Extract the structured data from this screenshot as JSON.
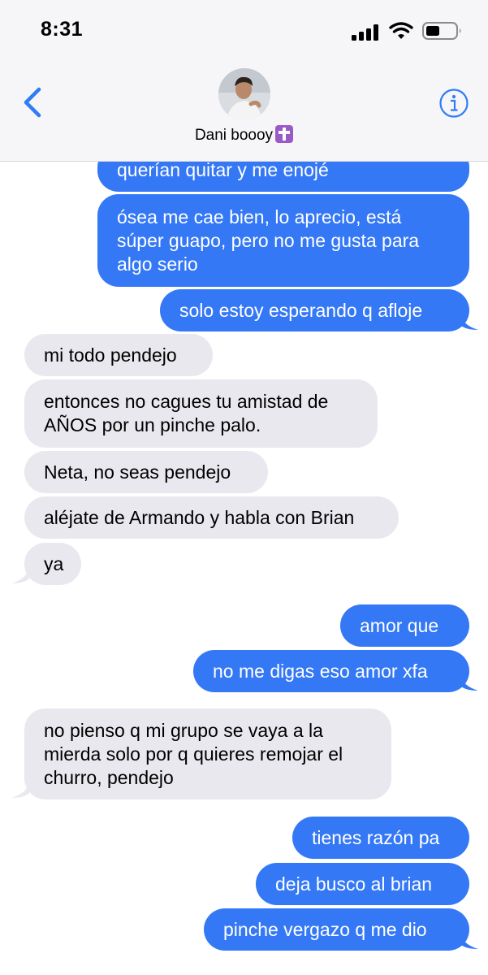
{
  "status_bar": {
    "time": "8:31",
    "icons": [
      "cellular-signal-icon",
      "wifi-icon",
      "battery-icon"
    ]
  },
  "header": {
    "contact_name": "Dani boooy",
    "contact_emoji": "latin-cross-emoji",
    "back_icon": "chevron-left-icon",
    "info_icon": "info-icon"
  },
  "colors": {
    "sent_bubble": "#3478f6",
    "received_bubble": "#e9e8ee",
    "accent": "#2f7cf6"
  },
  "messages": [
    {
      "from": "me",
      "text": "querían quitar y me enojé"
    },
    {
      "from": "me",
      "text": "ósea me cae bien, lo aprecio, está\nsúper guapo, pero no me gusta para\nalgo serio"
    },
    {
      "from": "me",
      "text": "solo estoy esperando q afloje"
    },
    {
      "from": "them",
      "text": "mi todo pendejo"
    },
    {
      "from": "them",
      "text": "entonces no cagues tu amistad de\nAÑOS por un pinche palo."
    },
    {
      "from": "them",
      "text": "Neta, no seas pendejo"
    },
    {
      "from": "them",
      "text": "aléjate de Armando y habla con Brian"
    },
    {
      "from": "them",
      "text": "ya"
    },
    {
      "from": "me",
      "text": "amor que"
    },
    {
      "from": "me",
      "text": "no me digas eso amor xfa"
    },
    {
      "from": "them",
      "text": "no pienso q mi grupo se vaya a la\nmierda solo por q quieres remojar el\nchurro, pendejo"
    },
    {
      "from": "me",
      "text": "tienes razón pa"
    },
    {
      "from": "me",
      "text": "deja busco al brian"
    },
    {
      "from": "me",
      "text": "pinche vergazo q me dio"
    }
  ]
}
